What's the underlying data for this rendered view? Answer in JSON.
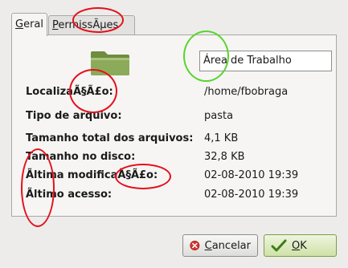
{
  "tabs": [
    {
      "mnemonic": "G",
      "rest": "eral"
    },
    {
      "mnemonic": "P",
      "rest": "ermissÃµes"
    }
  ],
  "name_field": {
    "value": "Área de Trabalho"
  },
  "properties": [
    {
      "label": "LocalizaÃ§Ã£o:",
      "value": "/home/fbobraga"
    },
    {
      "label": "Tipo de arquivo:",
      "value": "pasta"
    },
    {
      "label": "Tamanho total dos arquivos:",
      "value": "4,1 KB"
    },
    {
      "label": "Tamanho no disco:",
      "value": "32,8 KB"
    },
    {
      "label": "Ãltima modificaÃ§Ã£o:",
      "value": "02-08-2010 19:39"
    },
    {
      "label": "Ãltimo acesso:",
      "value": "02-08-2010 19:39"
    }
  ],
  "buttons": {
    "cancel": {
      "mnemonic": "C",
      "rest": "ancelar"
    },
    "ok": {
      "mnemonic": "O",
      "rest": "K"
    }
  },
  "icons": {
    "folder": "folder-icon",
    "cancel": "cancel-icon",
    "ok": "ok-checkmark-icon"
  },
  "colors": {
    "annotation_red": "#e5101a",
    "annotation_green": "#58d52c",
    "folder": "#8cab5a"
  }
}
